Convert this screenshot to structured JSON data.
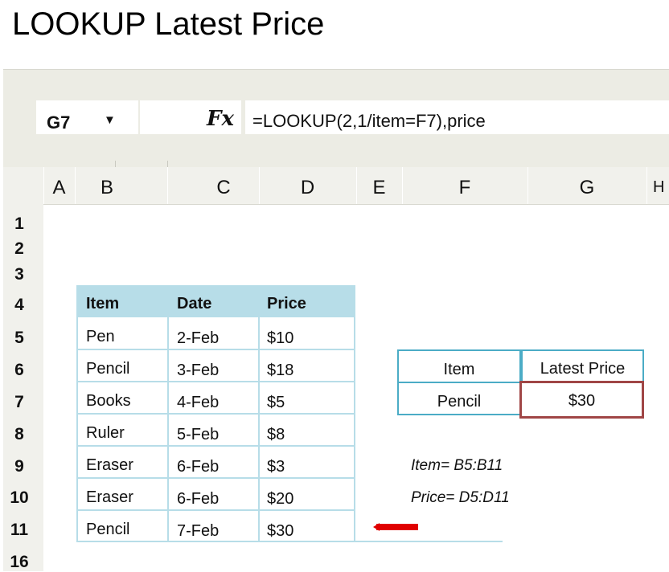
{
  "page": {
    "title": "LOOKUP Latest Price"
  },
  "excel": {
    "name_box": "G7",
    "dropdown_glyph": "▼",
    "fx_label": "Fx",
    "formula": "=LOOKUP(2,1/item=F7),price"
  },
  "columns": [
    "A",
    "B",
    "C",
    "D",
    "E",
    "F",
    "G",
    "H"
  ],
  "rows": [
    "1",
    "2",
    "3",
    "4",
    "5",
    "6",
    "7",
    "8",
    "9",
    "10",
    "11",
    "16"
  ],
  "table": {
    "headers": [
      "Item",
      "Date",
      "Price"
    ],
    "rows": [
      [
        "Pen",
        "2-Feb",
        "$10"
      ],
      [
        "Pencil",
        "3-Feb",
        "$18"
      ],
      [
        "Books",
        "4-Feb",
        "$5"
      ],
      [
        "Ruler",
        "5-Feb",
        "$8"
      ],
      [
        "Eraser",
        "6-Feb",
        "$3"
      ],
      [
        "Eraser",
        "6-Feb",
        "$20"
      ],
      [
        "Pencil",
        "7-Feb",
        "$30"
      ]
    ]
  },
  "lookup": {
    "item_label": "Item",
    "price_label": "Latest Price",
    "item_value": "Pencil",
    "price_value": "$30"
  },
  "notes": {
    "item_range": "Item= B5:B11",
    "price_range": "Price= D5:D11"
  },
  "colors": {
    "header_fill": "#B7DDE8",
    "border": "#4BACC6",
    "result_border": "#A04646",
    "arrow": "#E00000"
  }
}
